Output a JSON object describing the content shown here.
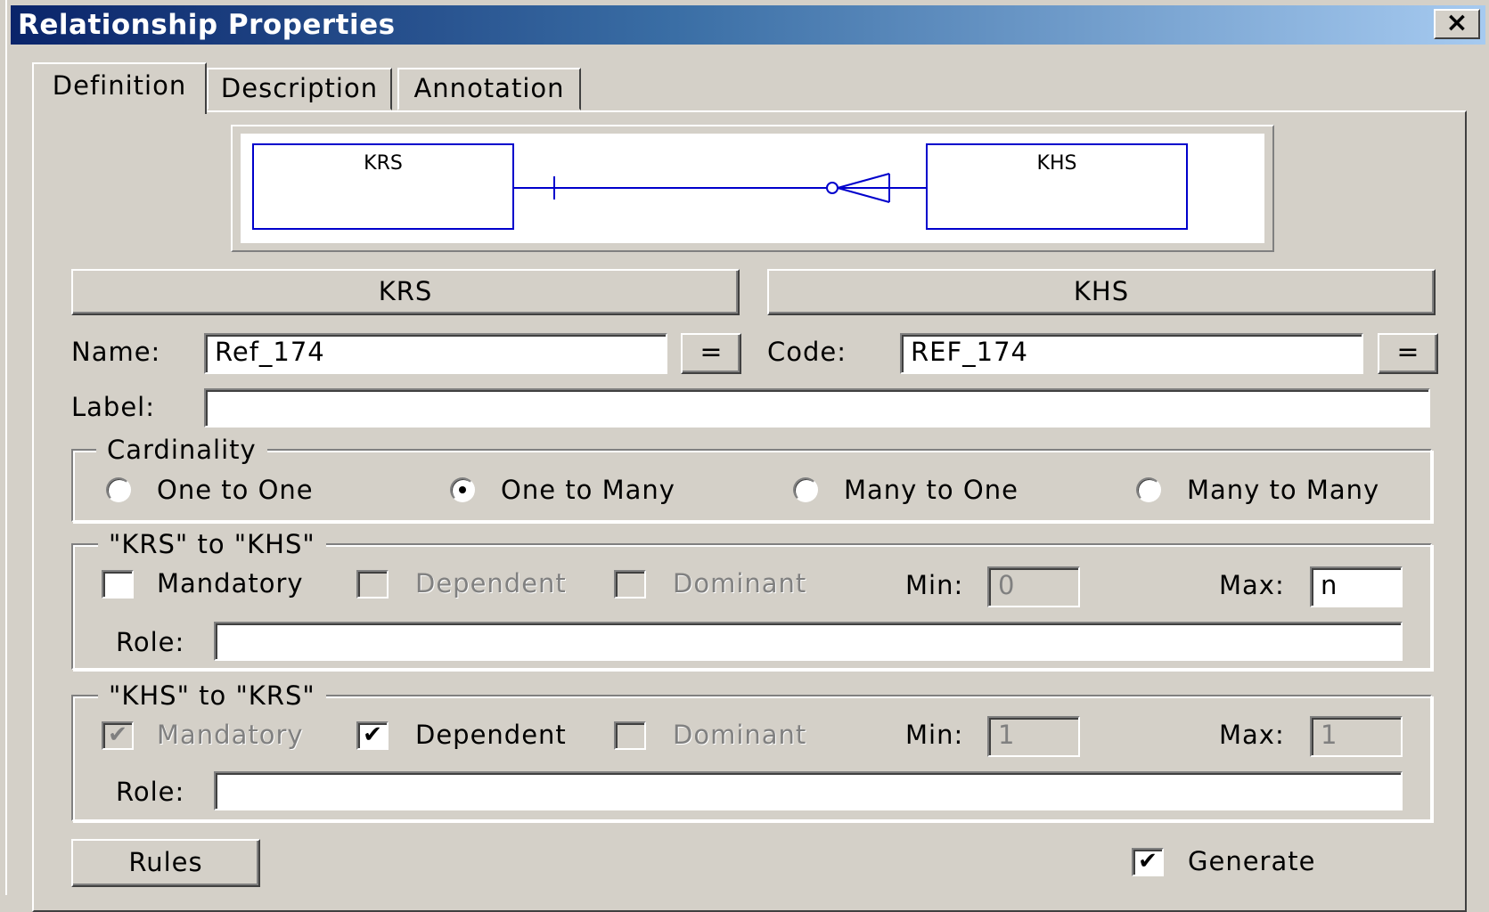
{
  "window": {
    "title": "Relationship Properties",
    "close_glyph": "×"
  },
  "tabs": [
    {
      "label": "Definition",
      "active": true
    },
    {
      "label": "Description",
      "active": false
    },
    {
      "label": "Annotation",
      "active": false
    }
  ],
  "diagram": {
    "left_entity": "KRS",
    "right_entity": "KHS",
    "line_color": "#0000cc"
  },
  "entity_buttons": {
    "left": "KRS",
    "right": "KHS"
  },
  "name": {
    "label": "Name:",
    "value": "Ref_174",
    "eq_label": "="
  },
  "code": {
    "label": "Code:",
    "value": "REF_174",
    "eq_label": "="
  },
  "label_field": {
    "label": "Label:",
    "value": ""
  },
  "cardinality": {
    "title": "Cardinality",
    "options": [
      {
        "label": "One to One",
        "selected": false
      },
      {
        "label": "One to Many",
        "selected": true
      },
      {
        "label": "Many to One",
        "selected": false
      },
      {
        "label": "Many to Many",
        "selected": false
      }
    ]
  },
  "krs_to_khs": {
    "title": "\"KRS\" to \"KHS\"",
    "mandatory": {
      "label": "Mandatory",
      "checked": false,
      "enabled": true
    },
    "dependent": {
      "label": "Dependent",
      "checked": false,
      "enabled": false
    },
    "dominant": {
      "label": "Dominant",
      "checked": false,
      "enabled": false
    },
    "min": {
      "label": "Min:",
      "value": "0"
    },
    "max": {
      "label": "Max:",
      "value": "n"
    },
    "role": {
      "label": "Role:",
      "value": ""
    }
  },
  "khs_to_krs": {
    "title": "\"KHS\" to \"KRS\"",
    "mandatory": {
      "label": "Mandatory",
      "checked": true,
      "enabled": false
    },
    "dependent": {
      "label": "Dependent",
      "checked": true,
      "enabled": true
    },
    "dominant": {
      "label": "Dominant",
      "checked": false,
      "enabled": false
    },
    "min": {
      "label": "Min:",
      "value": "1"
    },
    "max": {
      "label": "Max:",
      "value": "1"
    },
    "role": {
      "label": "Role:",
      "value": ""
    }
  },
  "footer": {
    "rules_label": "Rules",
    "generate_label": "Generate",
    "generate_checked": true
  },
  "check_glyph": "✔"
}
